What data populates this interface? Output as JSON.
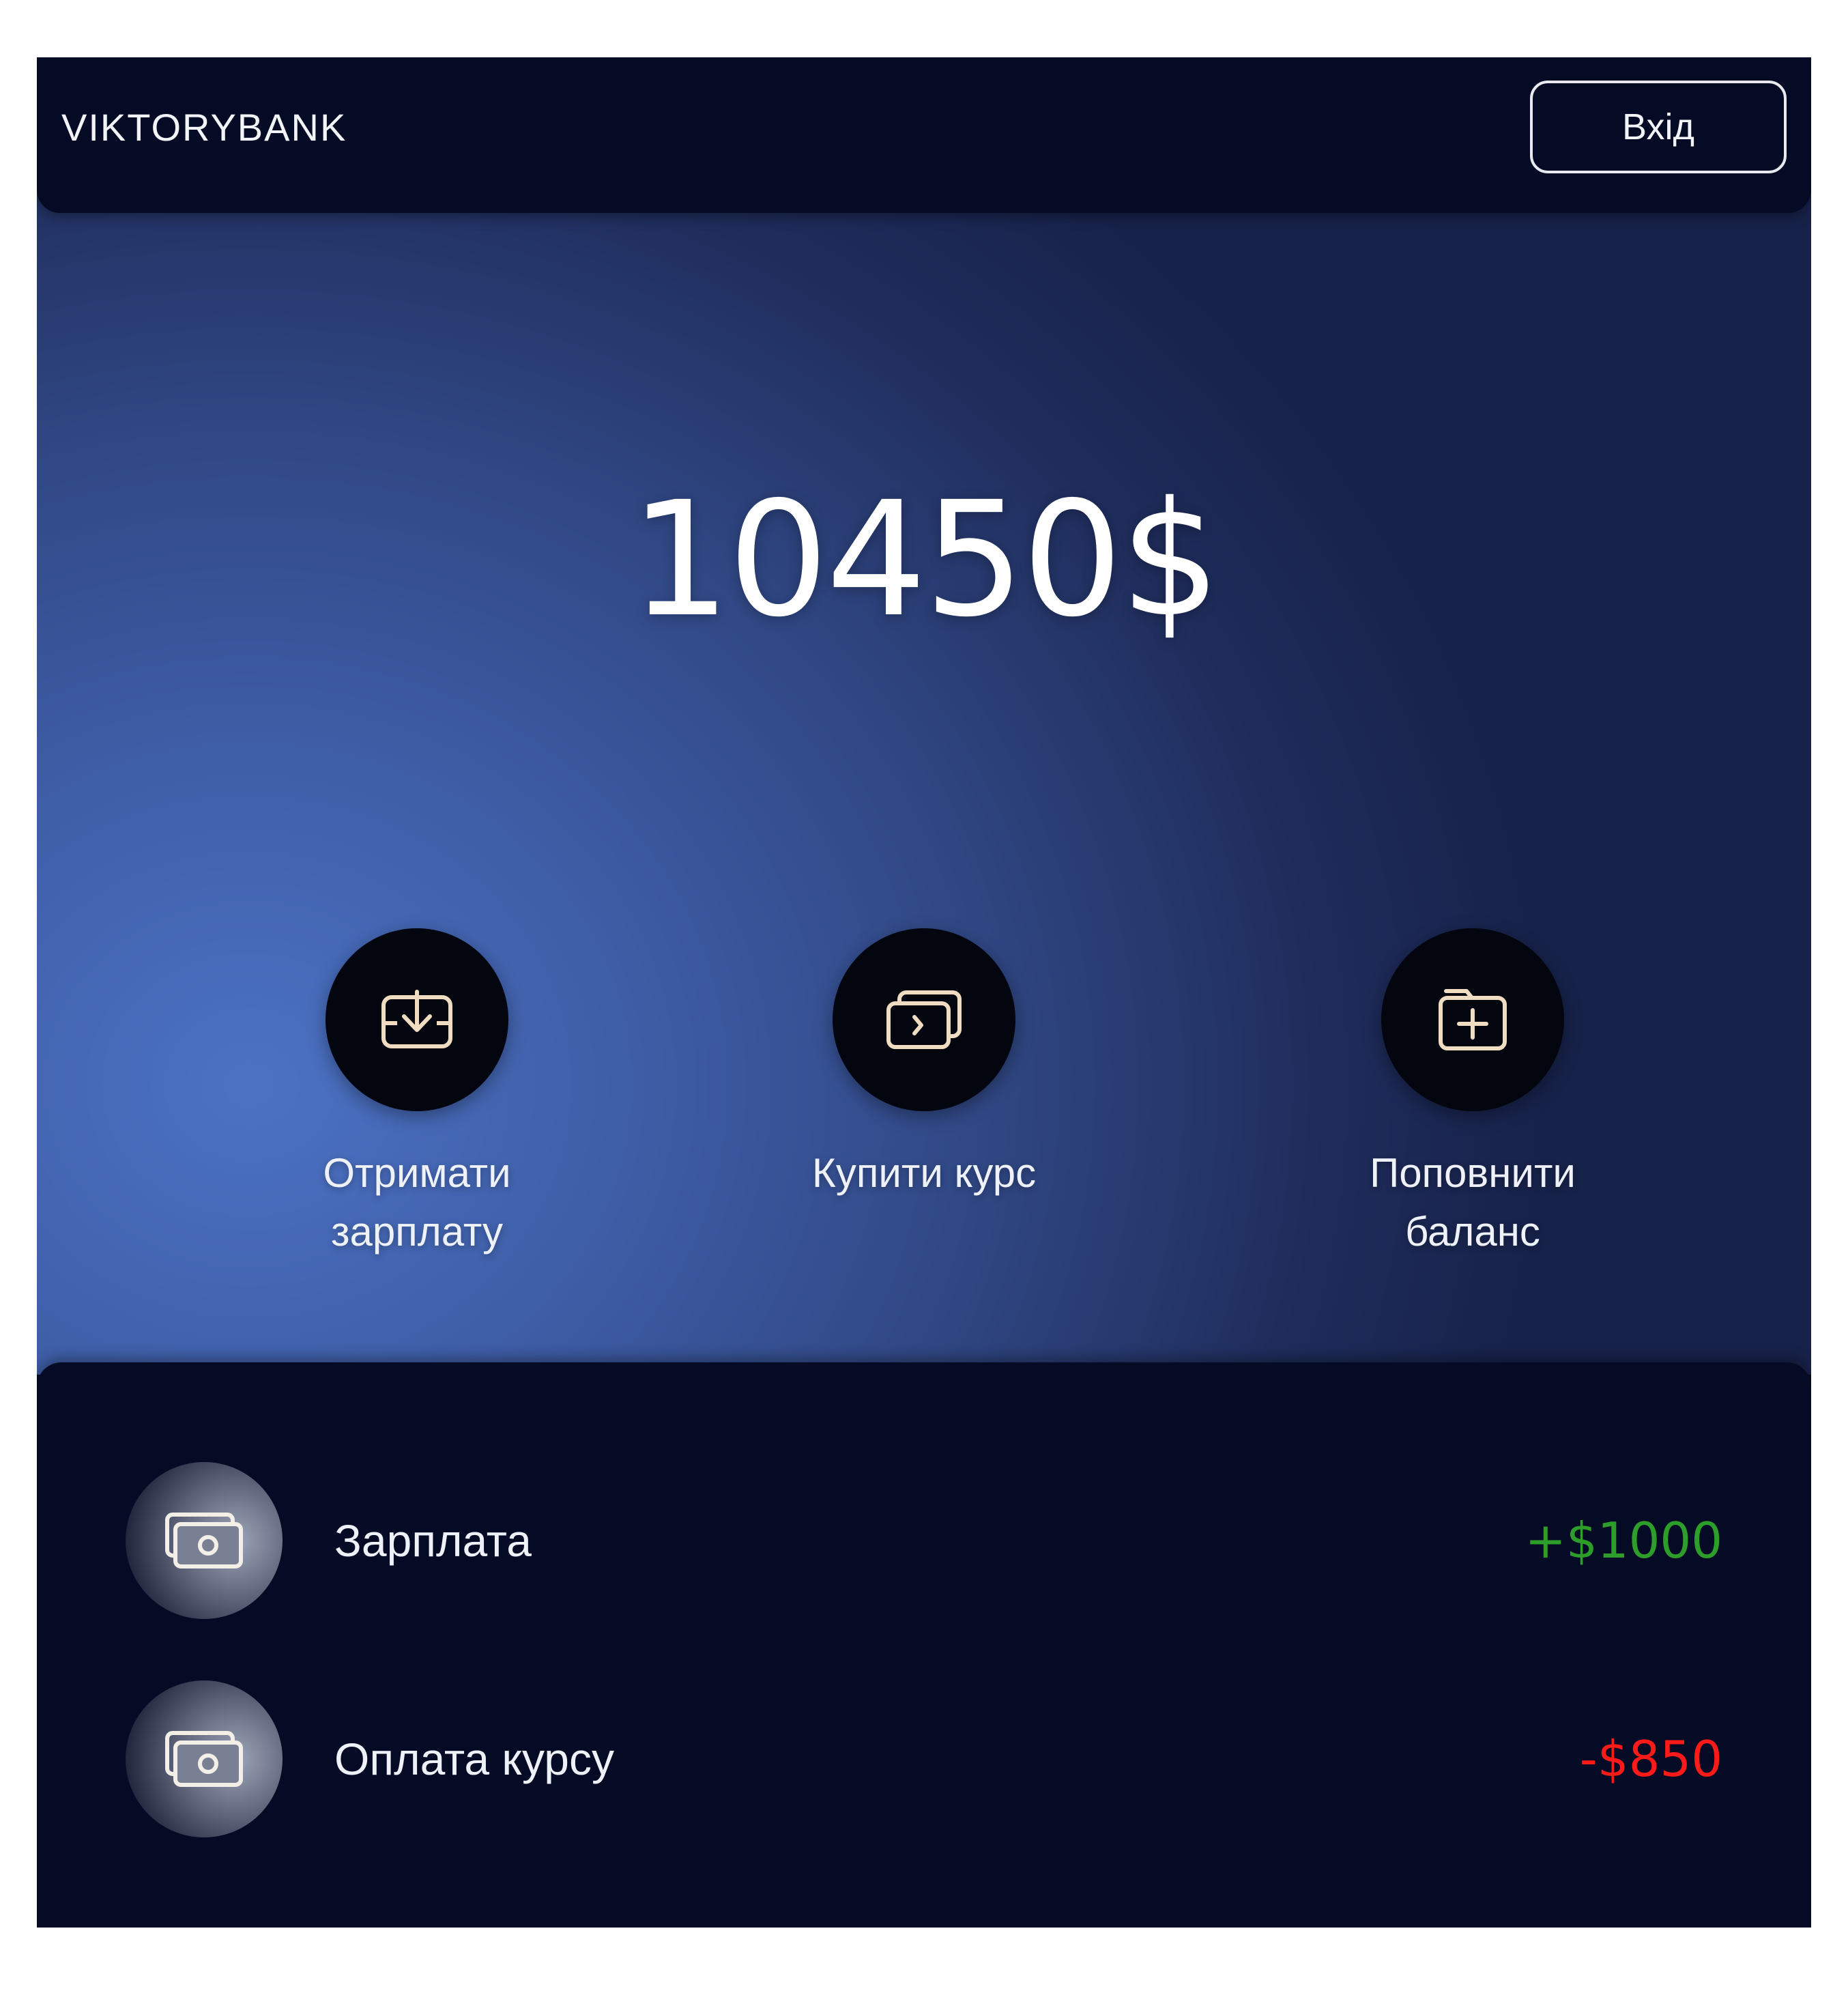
{
  "header": {
    "logo": "VIKTORYBANK",
    "login_label": "Вхід"
  },
  "balance": {
    "amount": "10450$"
  },
  "actions": [
    {
      "label": "Отримати\nзарплату",
      "icon": "download-tray-icon"
    },
    {
      "label": "Купити курс",
      "icon": "cards-chevron-icon"
    },
    {
      "label": "Поповнити\nбаланс",
      "icon": "folder-plus-icon"
    }
  ],
  "transactions": [
    {
      "name": "Зарплата",
      "amount": "+$1000",
      "color": "#2e9e2a",
      "icon": "cash-icon"
    },
    {
      "name": "Оплата курсу",
      "amount": "-$850",
      "color": "#ff1a1a",
      "icon": "cash-icon"
    }
  ],
  "colors": {
    "icon_stroke": "#f0dcc0"
  }
}
